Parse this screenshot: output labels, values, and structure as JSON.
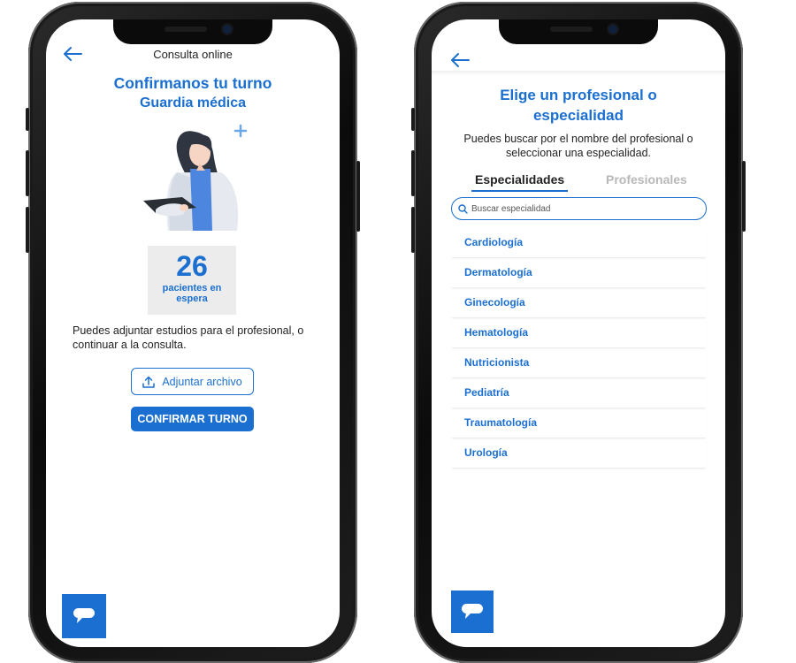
{
  "left_screen": {
    "header_title": "Consulta online",
    "title": "Confirmanos tu turno",
    "subtitle": "Guardia médica",
    "queue": {
      "count": "26",
      "label": "pacientes en espera"
    },
    "info_text": "Puedes adjuntar estudios para el profesional, o continuar a la consulta.",
    "attach_label": "Adjuntar archivo",
    "confirm_label": "CONFIRMAR TURNO"
  },
  "right_screen": {
    "title": "Elige un profesional o especialidad",
    "description": "Puedes buscar por el nombre del profesional o seleccionar una especialidad.",
    "tabs": [
      {
        "label": "Especialidades",
        "active": true
      },
      {
        "label": "Profesionales",
        "active": false
      }
    ],
    "search_placeholder": "Buscar especialidad",
    "specialties": [
      "Cardiología",
      "Dermatología",
      "Ginecología",
      "Hematología",
      "Nutricionista",
      "Pediatría",
      "Traumatología",
      "Urología"
    ]
  },
  "icons": {
    "back": "arrow-left-icon",
    "upload": "upload-icon",
    "chat": "chat-bubble-icon",
    "search": "search-icon",
    "plus": "plus-icon"
  },
  "colors": {
    "accent": "#1a6fd0",
    "queue_bg": "#ececec",
    "inactive_tab": "#b8b8b8"
  }
}
